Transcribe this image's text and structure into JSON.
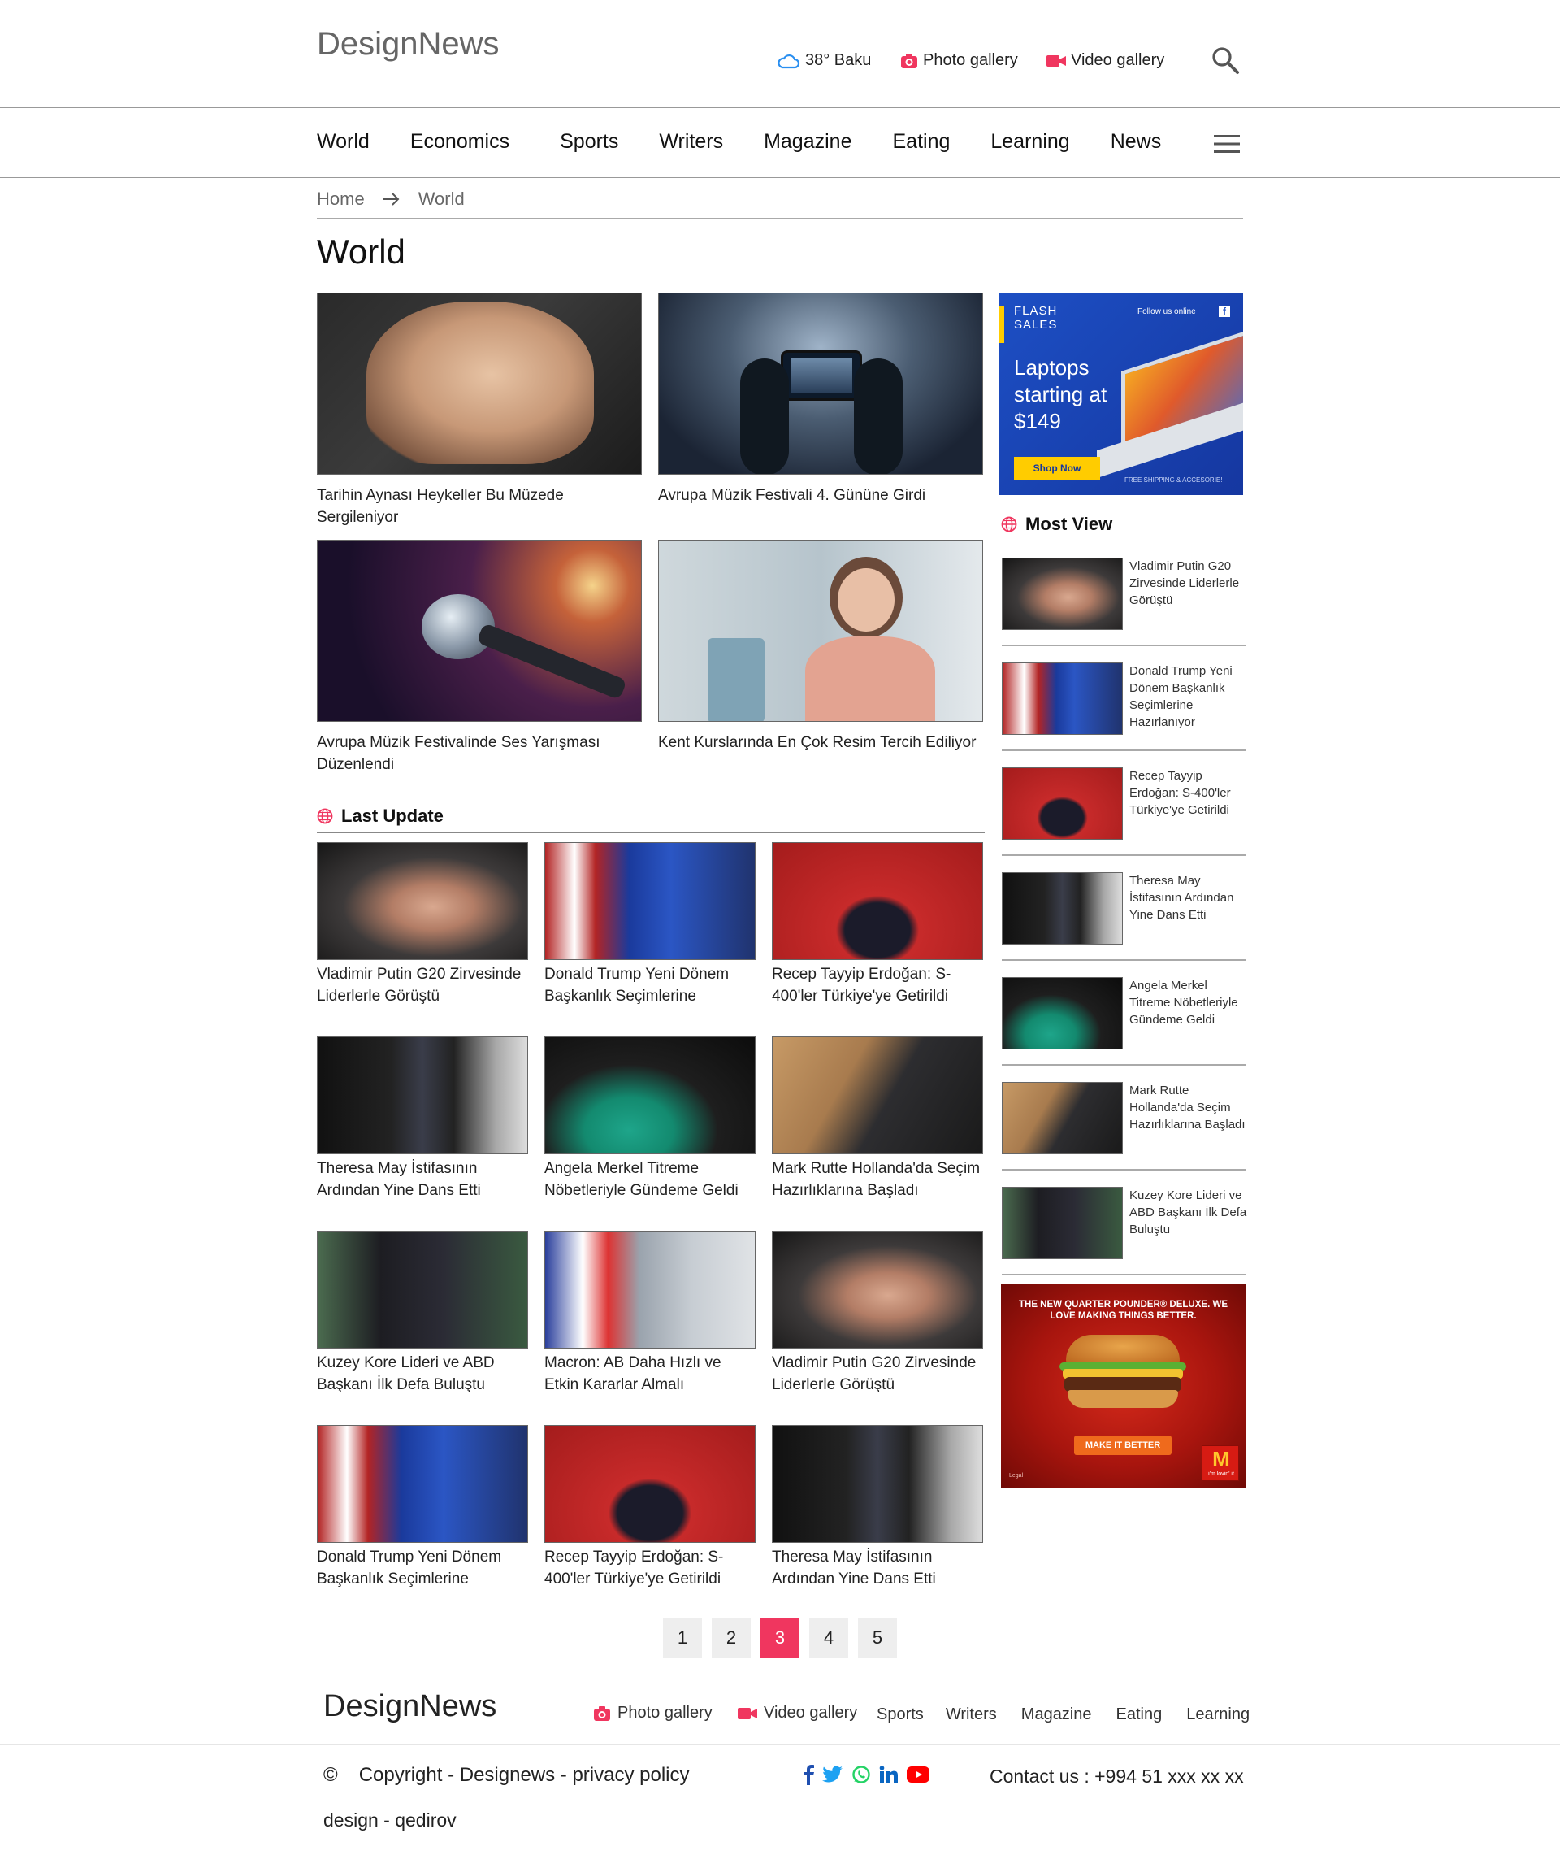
{
  "header": {
    "logo": "DesignNews",
    "weather": "38° Baku",
    "photo_gallery": "Photo gallery",
    "video_gallery": "Video gallery"
  },
  "nav": [
    "World",
    "Economics",
    "Sports",
    "Writers",
    "Magazine",
    "Eating",
    "Learning",
    "News"
  ],
  "breadcrumb": {
    "home": "Home",
    "current": "World"
  },
  "page_title": "World",
  "featured": [
    {
      "caption": "Tarihin Aynası Heykeller Bu Müzede Sergileniyor"
    },
    {
      "caption": "Avrupa Müzik Festivali 4. Gününe Girdi"
    },
    {
      "caption": "Avrupa Müzik Festivalinde Ses Yarışması Düzenlendi"
    },
    {
      "caption": "Kent Kurslarında En Çok Resim Tercih Ediliyor"
    }
  ],
  "last_update": {
    "title": "Last Update",
    "items": [
      {
        "caption": "Vladimir Putin G20 Zirvesinde Liderlerle Görüştü"
      },
      {
        "caption": "Donald Trump Yeni Dönem Başkanlık Seçimlerine"
      },
      {
        "caption": "Recep Tayyip Erdoğan: S-400'ler Türkiye'ye Getirildi"
      },
      {
        "caption": "Theresa May İstifasının Ardından Yine Dans Etti"
      },
      {
        "caption": "Angela Merkel Titreme Nöbetleriyle Gündeme Geldi"
      },
      {
        "caption": "Mark Rutte Hollanda'da Seçim Hazırlıklarına Başladı"
      },
      {
        "caption": "Kuzey Kore Lideri ve ABD Başkanı İlk Defa Buluştu"
      },
      {
        "caption": "Macron: AB Daha Hızlı ve Etkin Kararlar Almalı"
      },
      {
        "caption": "Vladimir Putin G20 Zirvesinde Liderlerle Görüştü"
      },
      {
        "caption": "Donald Trump Yeni Dönem Başkanlık Seçimlerine"
      },
      {
        "caption": "Recep Tayyip Erdoğan: S-400'ler Türkiye'ye Getirildi"
      },
      {
        "caption": "Theresa May İstifasının Ardından Yine Dans Etti"
      }
    ]
  },
  "ad1": {
    "flash": "FLASH SALES",
    "follow": "Follow us online",
    "headline": "Laptops starting at $149",
    "cta": "Shop Now",
    "note": "FREE SHIPPING & ACCESORIE!"
  },
  "most_view": {
    "title": "Most View",
    "items": [
      {
        "title": "Vladimir Putin G20 Zirvesinde Liderlerle Görüştü"
      },
      {
        "title": "Donald Trump Yeni Dönem Başkanlık Seçimlerine Hazırlanıyor"
      },
      {
        "title": "Recep Tayyip Erdoğan: S-400'ler Türkiye'ye Getirildi"
      },
      {
        "title": "Theresa May İstifasının Ardından Yine Dans Etti"
      },
      {
        "title": "Angela Merkel Titreme Nöbetleriyle Gündeme Geldi"
      },
      {
        "title": "Mark Rutte Hollanda'da Seçim Hazırlıklarına Başladı"
      },
      {
        "title": "Kuzey Kore Lideri ve ABD Başkanı İlk Defa Buluştu"
      }
    ]
  },
  "ad2": {
    "headline": "THE NEW QUARTER POUNDER® DELUXE. WE LOVE MAKING THINGS BETTER.",
    "cta": "MAKE IT BETTER",
    "legal": "Legal",
    "slogan": "i'm lovin' it"
  },
  "pagination": [
    "1",
    "2",
    "3",
    "4",
    "5"
  ],
  "pagination_active": "3",
  "footer": {
    "logo": "DesignNews",
    "photo_gallery": "Photo gallery",
    "video_gallery": "Video gallery",
    "links": [
      "Sports",
      "Writers",
      "Magazine",
      "Eating",
      "Learning"
    ],
    "copyright_symbol": "©",
    "copyright": "Copyright - Designews - privacy policy",
    "contact": "Contact us : +994 51 xxx xx xx",
    "design": "design - qedirov"
  },
  "colors": {
    "accent": "#f0365f",
    "weather_icon": "#2a8ff0",
    "facebook": "#1f4fb0",
    "twitter": "#1da1f2",
    "whatsapp": "#25d366",
    "linkedin": "#0a66c2",
    "youtube": "#ff0000"
  }
}
